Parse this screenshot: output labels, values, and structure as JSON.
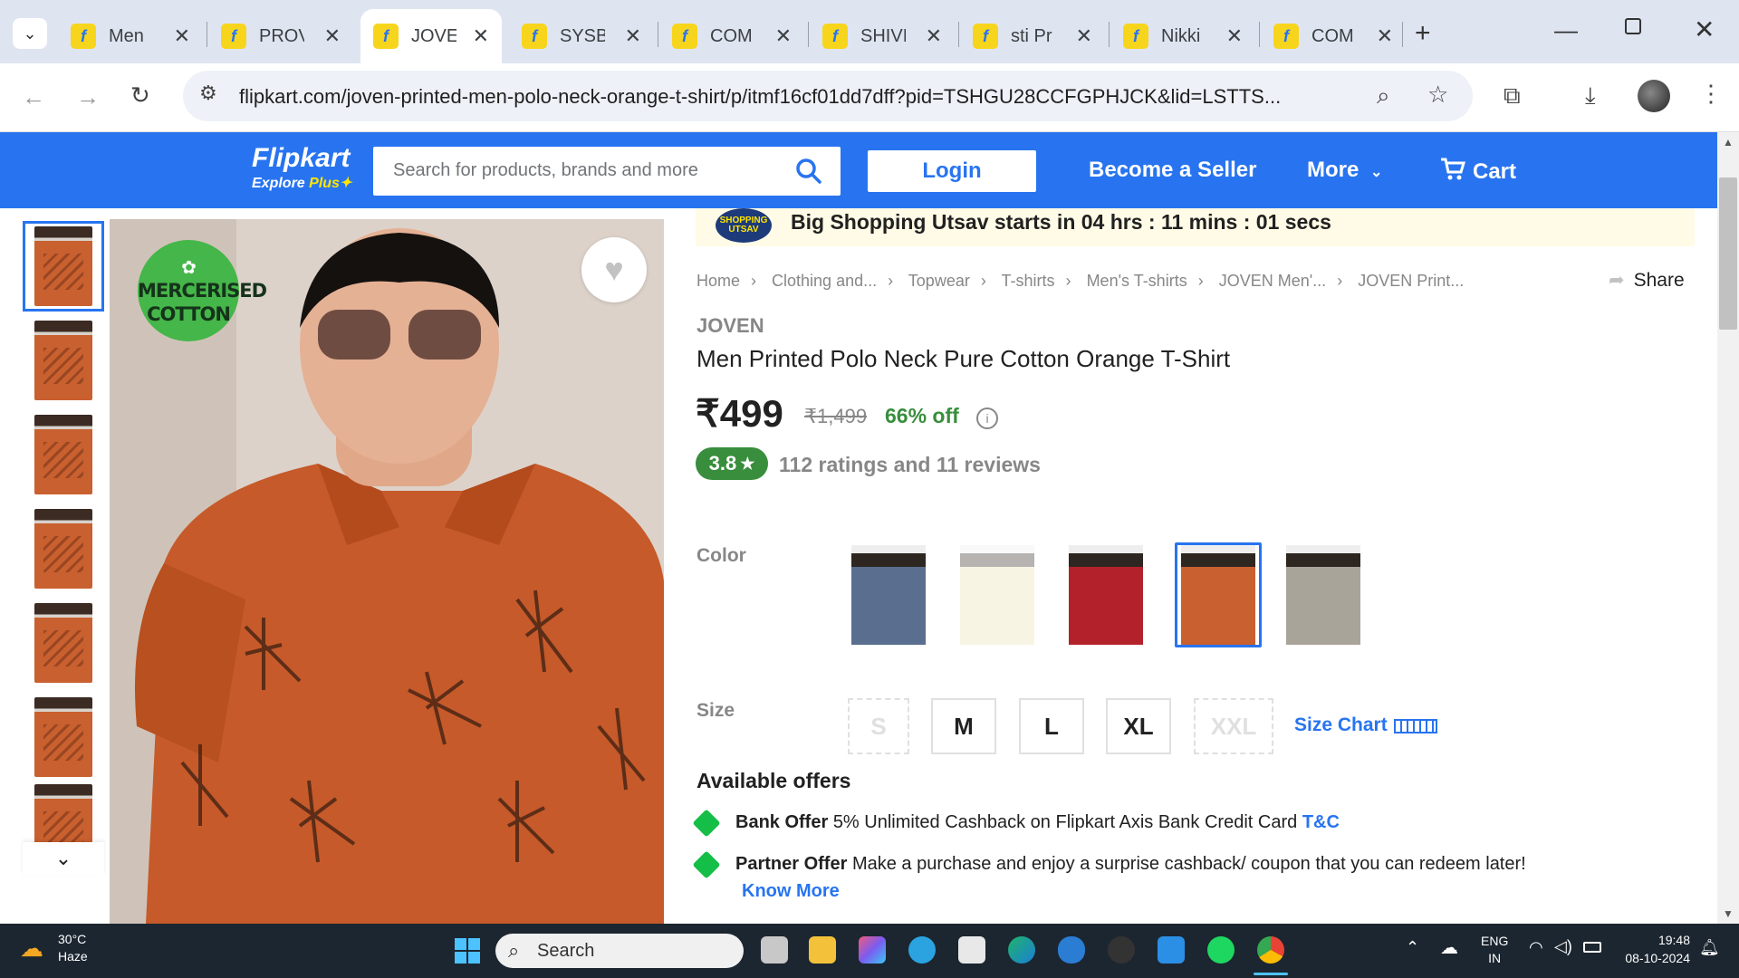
{
  "browser": {
    "tabs": [
      {
        "title": "Men"
      },
      {
        "title": "PROV"
      },
      {
        "title": "JOVEN"
      },
      {
        "title": "SYSBI"
      },
      {
        "title": "COM"
      },
      {
        "title": "SHIVI"
      },
      {
        "title": "sti Pr"
      },
      {
        "title": "Nikki"
      },
      {
        "title": "COM"
      }
    ],
    "url": "flipkart.com/joven-printed-men-polo-neck-orange-t-shirt/p/itmf16cf01dd7dff?pid=TSHGU28CCFGPHJCK&lid=LSTTS..."
  },
  "header": {
    "logo": "Flipkart",
    "logo_sub": "Explore",
    "logo_plus": "Plus",
    "search_placeholder": "Search for products, brands and more",
    "login": "Login",
    "seller": "Become a Seller",
    "more": "More",
    "cart": "Cart"
  },
  "gallery": {
    "badge_line1": "MERCERISED",
    "badge_line2": "COTTON"
  },
  "banner": {
    "text": "Big Shopping Utsav starts in 04 hrs : 11 mins : 01 secs",
    "logo": "SHOPPING UTSAV"
  },
  "breadcrumb": [
    "Home",
    "Clothing and...",
    "Topwear",
    "T-shirts",
    "Men's T-shirts",
    "JOVEN Men'...",
    "JOVEN Print..."
  ],
  "share": "Share",
  "product": {
    "brand": "JOVEN",
    "name": "Men Printed Polo Neck Pure Cotton Orange T-Shirt",
    "price": "₹499",
    "mrp": "₹1,499",
    "discount": "66% off",
    "rating": "3.8",
    "rating_text": "112 ratings and 11 reviews"
  },
  "color": {
    "label": "Color",
    "swatches": [
      {
        "color": "#5a6f8f",
        "available": true,
        "selected": false
      },
      {
        "color": "#e9dfb0",
        "available": false,
        "selected": false
      },
      {
        "color": "#b3222a",
        "available": true,
        "selected": false
      },
      {
        "color": "#c9602f",
        "available": true,
        "selected": true
      },
      {
        "color": "#a9a49a",
        "available": true,
        "selected": false
      }
    ]
  },
  "size": {
    "label": "Size",
    "options": [
      {
        "label": "S",
        "available": false
      },
      {
        "label": "M",
        "available": true
      },
      {
        "label": "L",
        "available": true
      },
      {
        "label": "XL",
        "available": true
      },
      {
        "label": "XXL",
        "available": false
      }
    ],
    "chart": "Size Chart"
  },
  "offers": {
    "title": "Available offers",
    "items": [
      {
        "type": "Bank Offer",
        "text": "5% Unlimited Cashback on Flipkart Axis Bank Credit Card",
        "link": "T&C"
      },
      {
        "type": "Partner Offer",
        "text": "Make a purchase and enjoy a surprise cashback/ coupon that you can redeem later!",
        "link": "Know More"
      }
    ]
  },
  "taskbar": {
    "temp": "30°C",
    "weather": "Haze",
    "search": "Search",
    "lang1": "ENG",
    "lang2": "IN",
    "time": "19:48",
    "date": "08-10-2024"
  },
  "colors": {
    "brand": "#2874f0",
    "accent": "#ffe500",
    "green": "#388e3c"
  }
}
